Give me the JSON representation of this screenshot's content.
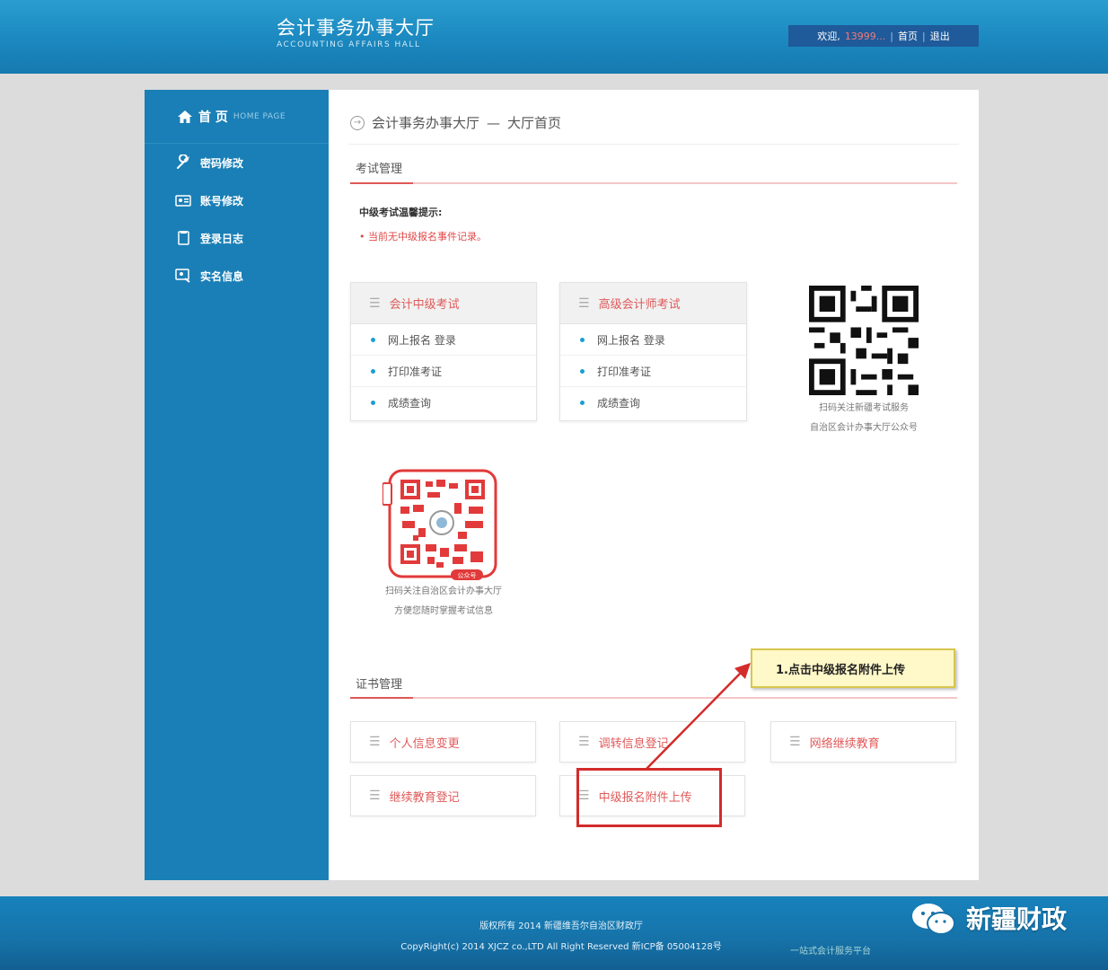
{
  "header": {
    "title": "会计事务办事大厅",
    "subtitle": "ACCOUNTING AFFAIRS HALL",
    "greeting": "欢迎,",
    "phone": "13999...",
    "home_link": "首页",
    "logout_link": "退出",
    "separator": "|"
  },
  "sidebar": {
    "home_cn": "首 页",
    "home_en": "HOME PAGE",
    "items": [
      {
        "label": "密码修改",
        "icon": "wrench-icon"
      },
      {
        "label": "账号修改",
        "icon": "id-card-icon"
      },
      {
        "label": "登录日志",
        "icon": "document-icon"
      },
      {
        "label": "实名信息",
        "icon": "profile-icon"
      }
    ]
  },
  "breadcrumb": {
    "root": "会计事务办事大厅",
    "separator": "—",
    "current": "大厅首页"
  },
  "exam_section": {
    "title": "考试管理",
    "notice_title": "中级考试温馨提示:",
    "notice_item": "• 当前无中级报名事件记录。",
    "cards": [
      {
        "title": "会计中级考试",
        "rows": [
          "网上报名 登录",
          "打印准考证",
          "成绩查询"
        ]
      },
      {
        "title": "高级会计师考试",
        "rows": [
          "网上报名 登录",
          "打印准考证",
          "成绩查询"
        ]
      }
    ],
    "qr1_caption_line1": "扫码关注新疆考试服务",
    "qr1_caption_line2": "自治区会计办事大厅公众号",
    "qr2_caption_line1": "扫码关注自治区会计办事大厅",
    "qr2_caption_line2": "方便您随时掌握考试信息",
    "qr2_badge": "公众号"
  },
  "cert_section": {
    "title": "证书管理",
    "buttons": [
      "个人信息变更",
      "调转信息登记",
      "网络继续教育",
      "继续教育登记",
      "中级报名附件上传"
    ]
  },
  "annotation": {
    "callout": "1.点击中级报名附件上传"
  },
  "footer": {
    "line1": "版权所有 2014 新疆维吾尔自治区财政厅",
    "line2": "CopyRight(c) 2014 XJCZ co.,LTD  All Right Reserved  新ICP备 05004128号"
  },
  "watermark": {
    "name": "新疆财政",
    "sub": "一站式会计服务平台"
  },
  "colors": {
    "header_blue": "#1b88bf",
    "sidebar_blue": "#1a7fb6",
    "accent_red": "#e05a5a",
    "callout_yellow": "#fff8c8"
  }
}
